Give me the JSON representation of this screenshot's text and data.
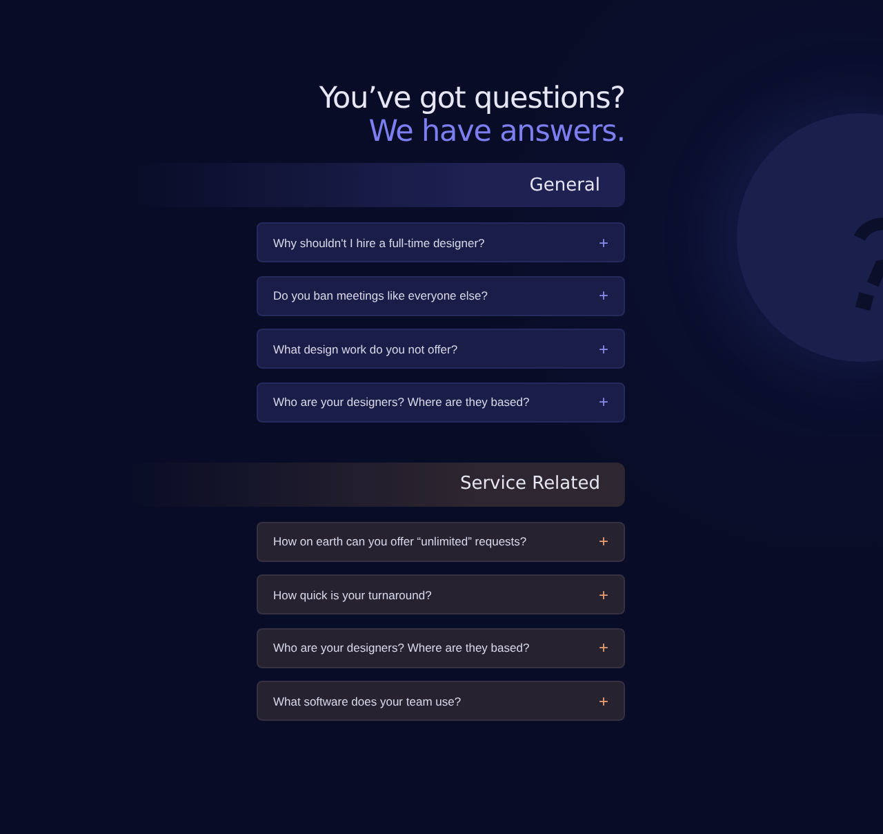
{
  "heading": {
    "line_1": "You’ve got questions?",
    "line_2": "We have answers."
  },
  "sections": [
    {
      "title": "General",
      "color": "#8a8cf0",
      "items": [
        {
          "question": "Why shouldn't I hire a full-time designer?",
          "icon": "+",
          "expanded": false
        },
        {
          "question": "Do you ban meetings like everyone else?",
          "icon": "+",
          "expanded": false
        },
        {
          "question": "What design work do you not offer?",
          "icon": "+",
          "expanded": false
        },
        {
          "question": "Who are your designers? Where are they based?",
          "icon": "+",
          "expanded": false
        }
      ]
    },
    {
      "title": "Service Related",
      "color": "#f0a070",
      "items": [
        {
          "question": "How on earth can you offer “unlimited” requests?",
          "icon": "+",
          "expanded": false
        },
        {
          "question": "How quick is your turnaround?",
          "icon": "+",
          "expanded": false
        },
        {
          "question": "Who are your designers? Where are they based?",
          "icon": "+",
          "expanded": false
        },
        {
          "question": "What software does your team use?",
          "icon": "+",
          "expanded": false
        }
      ]
    }
  ]
}
